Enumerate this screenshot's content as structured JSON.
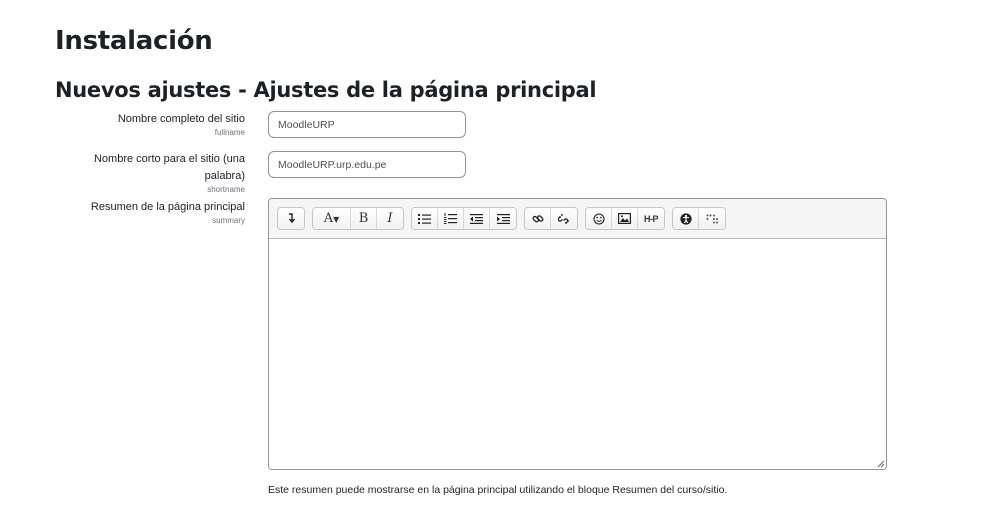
{
  "page": {
    "title": "Instalación",
    "section_title": "Nuevos ajustes - Ajustes de la página principal"
  },
  "fields": {
    "fullname": {
      "label": "Nombre completo del sitio",
      "name": "fullname",
      "value": "MoodleURP"
    },
    "shortname": {
      "label": "Nombre corto para el sitio (una palabra)",
      "name": "shortname",
      "value": "MoodleURP.urp.edu.pe"
    },
    "summary": {
      "label": "Resumen de la página principal",
      "name": "summary",
      "value": "",
      "help": "Este resumen puede mostrarse en la página principal utilizando el bloque Resumen del curso/sitio."
    }
  },
  "toolbar": {
    "groups": [
      [
        "collapse-icon"
      ],
      [
        "font-style-icon",
        "bold-icon",
        "italic-icon"
      ],
      [
        "unordered-list-icon",
        "ordered-list-icon",
        "outdent-icon",
        "indent-icon"
      ],
      [
        "link-icon",
        "unlink-icon"
      ],
      [
        "emoji-icon",
        "image-icon",
        "h5p-icon"
      ],
      [
        "accessibility-checker-icon",
        "screenreader-helper-icon"
      ]
    ],
    "font_label": "A",
    "bold_label": "B",
    "italic_label": "I",
    "h5p_label": "H-P"
  }
}
